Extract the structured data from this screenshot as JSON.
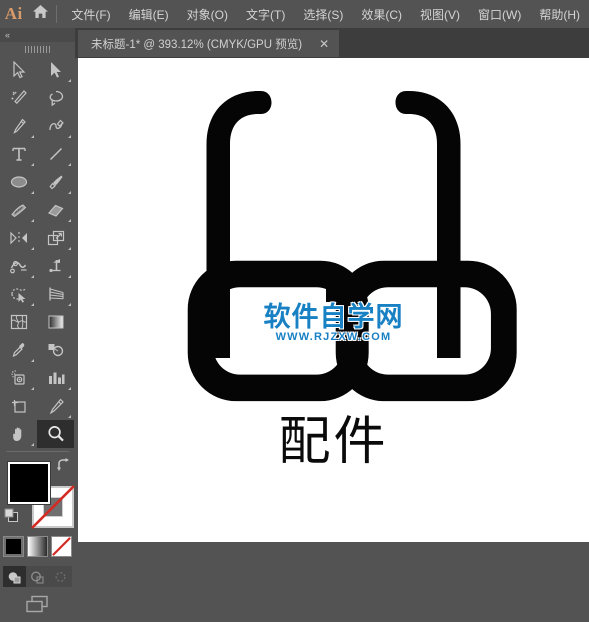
{
  "app": {
    "logo_text": "Ai",
    "home_icon": "home-icon",
    "colors": {
      "menubar_bg": "#535353",
      "tabbar_bg": "#3d3d3d",
      "tab_bg": "#535353",
      "panel_bg": "#535353",
      "canvas_bg": "#ffffff",
      "logo_accent": "#d89b6a",
      "watermark_blue": "#1881c4",
      "artwork_black": "#000000",
      "selected_tool_bg": "#2e2e2e"
    }
  },
  "menu": {
    "items": [
      {
        "label": "文件(F)",
        "name": "menu-file"
      },
      {
        "label": "编辑(E)",
        "name": "menu-edit"
      },
      {
        "label": "对象(O)",
        "name": "menu-object"
      },
      {
        "label": "文字(T)",
        "name": "menu-type"
      },
      {
        "label": "选择(S)",
        "name": "menu-select"
      },
      {
        "label": "效果(C)",
        "name": "menu-effect"
      },
      {
        "label": "视图(V)",
        "name": "menu-view"
      },
      {
        "label": "窗口(W)",
        "name": "menu-window"
      },
      {
        "label": "帮助(H)",
        "name": "menu-help"
      }
    ]
  },
  "tabbar": {
    "tab": {
      "label": "未标题-1* @ 393.12% (CMYK/GPU 预览)",
      "document_name": "未标题-1",
      "modified": true,
      "zoom": "393.12%",
      "color_mode": "CMYK",
      "render_mode": "GPU 预览",
      "close_label": "✕"
    }
  },
  "toolpanel": {
    "collapse_label": "«",
    "tools": [
      {
        "name": "selection-tool",
        "label": "选择工具",
        "selected": false,
        "flyout": false
      },
      {
        "name": "direct-selection-tool",
        "label": "直接选择工具",
        "selected": false,
        "flyout": true
      },
      {
        "name": "magic-wand-tool",
        "label": "魔棒工具",
        "selected": false,
        "flyout": false
      },
      {
        "name": "lasso-tool",
        "label": "套索工具",
        "selected": false,
        "flyout": false
      },
      {
        "name": "pen-tool",
        "label": "钢笔工具",
        "selected": false,
        "flyout": true
      },
      {
        "name": "curvature-tool",
        "label": "曲率工具",
        "selected": false,
        "flyout": false
      },
      {
        "name": "type-tool",
        "label": "文字工具",
        "selected": false,
        "flyout": true
      },
      {
        "name": "line-segment-tool",
        "label": "直线段工具",
        "selected": false,
        "flyout": true
      },
      {
        "name": "ellipse-tool",
        "label": "椭圆工具",
        "selected": false,
        "flyout": true
      },
      {
        "name": "paintbrush-tool",
        "label": "画笔工具",
        "selected": false,
        "flyout": true
      },
      {
        "name": "shaper-tool",
        "label": "Shaper 工具",
        "selected": false,
        "flyout": true
      },
      {
        "name": "eraser-tool",
        "label": "橡皮擦工具",
        "selected": false,
        "flyout": true
      },
      {
        "name": "rotate-tool",
        "label": "旋转工具",
        "selected": false,
        "flyout": true
      },
      {
        "name": "scale-tool",
        "label": "比例缩放工具",
        "selected": false,
        "flyout": true
      },
      {
        "name": "width-tool",
        "label": "宽度工具",
        "selected": false,
        "flyout": true
      },
      {
        "name": "free-transform-tool",
        "label": "自由变换工具",
        "selected": false,
        "flyout": true
      },
      {
        "name": "shape-builder-tool",
        "label": "形状生成器工具",
        "selected": false,
        "flyout": true
      },
      {
        "name": "perspective-grid-tool",
        "label": "透视网格工具",
        "selected": false,
        "flyout": true
      },
      {
        "name": "mesh-tool",
        "label": "网格工具",
        "selected": false,
        "flyout": false
      },
      {
        "name": "gradient-tool",
        "label": "渐变工具",
        "selected": false,
        "flyout": false
      },
      {
        "name": "eyedropper-tool",
        "label": "吸管工具",
        "selected": false,
        "flyout": true
      },
      {
        "name": "blend-tool",
        "label": "混合工具",
        "selected": false,
        "flyout": false
      },
      {
        "name": "symbol-sprayer-tool",
        "label": "符号喷枪工具",
        "selected": false,
        "flyout": true
      },
      {
        "name": "column-graph-tool",
        "label": "柱形图工具",
        "selected": false,
        "flyout": true
      },
      {
        "name": "artboard-tool",
        "label": "画板工具",
        "selected": false,
        "flyout": false
      },
      {
        "name": "slice-tool",
        "label": "切片工具",
        "selected": false,
        "flyout": true
      },
      {
        "name": "hand-tool",
        "label": "抓手工具",
        "selected": false,
        "flyout": true
      },
      {
        "name": "zoom-tool",
        "label": "缩放工具",
        "selected": true,
        "flyout": false
      }
    ],
    "fill_stroke": {
      "fill_color": "#000000",
      "stroke_color": "#ffffff",
      "swap_label": "互换填色和描边",
      "default_label": "默认填色和描边"
    },
    "paint_modes": [
      {
        "name": "color-solid-swatch",
        "label": "颜色",
        "active": true
      },
      {
        "name": "gradient-swatch",
        "label": "渐变",
        "active": false
      },
      {
        "name": "none-swatch",
        "label": "无",
        "active": false
      }
    ],
    "draw_modes": [
      {
        "name": "draw-normal-mode",
        "label": "正常绘图",
        "active": true
      },
      {
        "name": "draw-behind-mode",
        "label": "背面绘图",
        "active": false
      },
      {
        "name": "draw-inside-mode",
        "label": "内部绘图",
        "active": false
      }
    ],
    "screen_mode": {
      "name": "change-screen-mode",
      "label": "更改屏幕模式"
    }
  },
  "canvas": {
    "artwork": {
      "name": "eyeglasses-logo",
      "caption": "配件",
      "color": "#000000"
    },
    "watermark": {
      "main": "软件自学网",
      "sub": "WWW.RJZXW.COM",
      "color": "#1881c4"
    }
  }
}
